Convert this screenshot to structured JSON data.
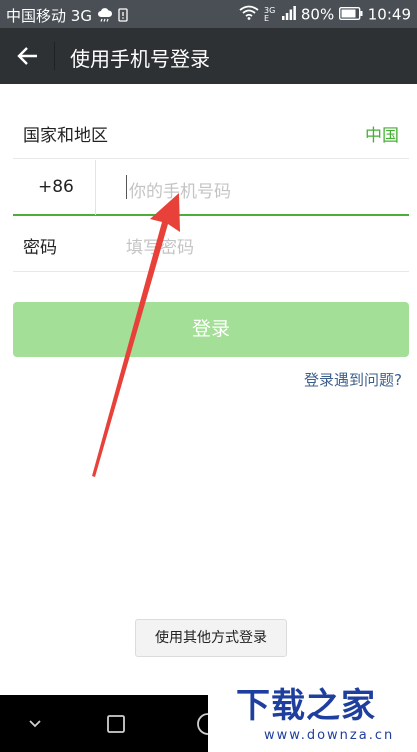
{
  "status_bar": {
    "carrier": "中国移动",
    "network": "3G",
    "battery_percent": "80%",
    "time": "10:49",
    "signal_top": "3G",
    "signal_bottom": "E"
  },
  "app_bar": {
    "back_icon": "arrow-left-icon",
    "title": "使用手机号登录"
  },
  "form": {
    "country_label": "国家和地区",
    "country_value": "中国",
    "country_code": "+86",
    "phone_placeholder": "你的手机号码",
    "password_label": "密码",
    "password_placeholder": "填写密码"
  },
  "actions": {
    "login_label": "登录",
    "help_link": "登录遇到问题?",
    "other_login_label": "使用其他方式登录"
  },
  "nav_bar": {
    "icons": [
      "chevron-down-icon",
      "square-recent-icon",
      "circle-home-icon"
    ]
  },
  "watermark": {
    "title": "下载之家",
    "url": "www.downza.cn"
  },
  "colors": {
    "status_bar_bg": "#4a4f55",
    "app_bar_bg": "#2d3133",
    "accent_green": "#45b035",
    "login_button_disabled": "#a3df96",
    "link_blue": "#3d5f8d",
    "annotation_red": "#e8413a",
    "watermark_blue": "#1f3f9e"
  }
}
